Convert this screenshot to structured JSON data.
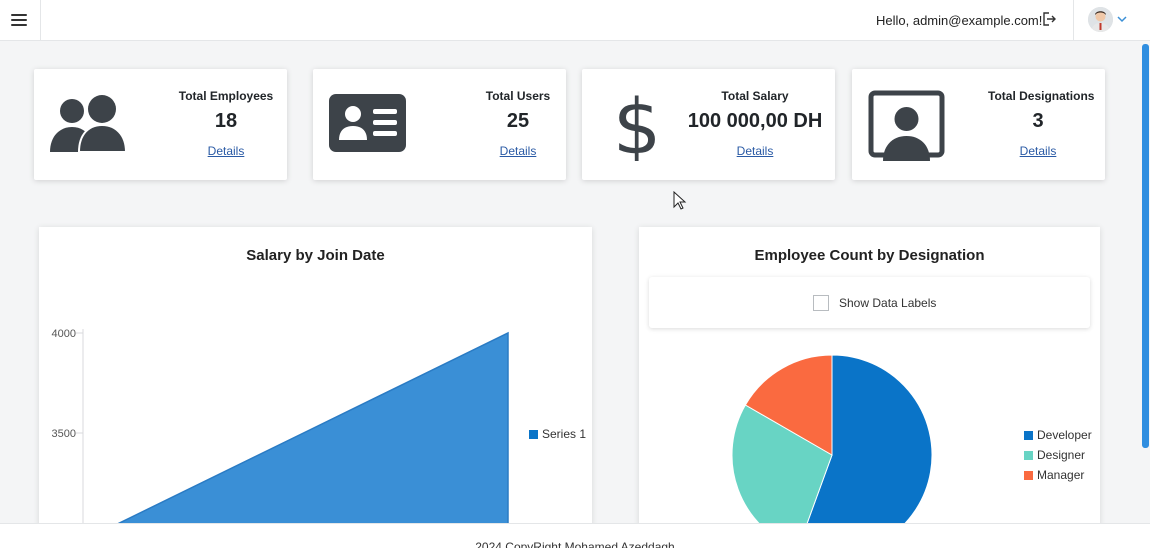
{
  "header": {
    "greeting": "Hello, admin@example.com!",
    "menu_icon": "hamburger-menu-icon",
    "logout_icon": "logout-icon",
    "avatar_icon": "user-avatar",
    "dropdown_icon": "chevron-down-icon"
  },
  "stats": [
    {
      "title": "Total Employees",
      "value": "18",
      "link": "Details",
      "icon": "users-icon"
    },
    {
      "title": "Total Users",
      "value": "25",
      "link": "Details",
      "icon": "id-card-icon"
    },
    {
      "title": "Total Salary",
      "value": "100 000,00 DH",
      "link": "Details",
      "icon": "dollar-icon"
    },
    {
      "title": "Total Designations",
      "value": "3",
      "link": "Details",
      "icon": "user-screen-icon"
    }
  ],
  "salary_chart": {
    "title": "Salary by Join Date",
    "ytick_4000": "4000",
    "ytick_3500": "3500",
    "legend": "Series 1"
  },
  "designation_chart": {
    "title": "Employee Count by Designation",
    "toggle_label": "Show Data Labels",
    "legend": [
      "Developer",
      "Designer",
      "Manager"
    ]
  },
  "chart_data": [
    {
      "type": "area",
      "title": "Salary by Join Date",
      "series": [
        {
          "name": "Series 1",
          "values": [
            3000,
            3500,
            4000
          ]
        }
      ],
      "yticks": [
        3500,
        4000
      ],
      "ylim": [
        3000,
        4000
      ],
      "legend": "right",
      "color": "#3a8fd6"
    },
    {
      "type": "pie",
      "title": "Employee Count by Designation",
      "categories": [
        "Developer",
        "Designer",
        "Manager"
      ],
      "values": [
        10,
        5,
        3
      ],
      "colors": [
        "#0a74c8",
        "#68d4c4",
        "#fa6a40"
      ],
      "legend": "right"
    }
  ],
  "footer": {
    "text": "2024 CopyRight Mohamed Azeddagh"
  }
}
